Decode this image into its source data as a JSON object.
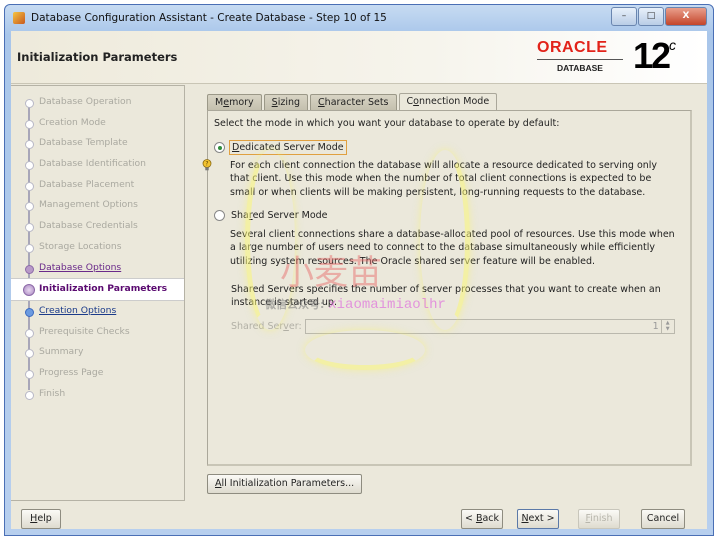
{
  "window": {
    "title": "Database Configuration Assistant - Create Database - Step 10 of 15",
    "minimize": "–",
    "maximize": "□",
    "close": "X"
  },
  "header": {
    "page_title": "Initialization Parameters",
    "logo_brand": "ORACLE",
    "logo_product": "DATABASE",
    "logo_version": "12",
    "logo_suffix": "c"
  },
  "sidebar": {
    "steps": [
      {
        "label": "Database Operation",
        "state": "done"
      },
      {
        "label": "Creation Mode",
        "state": "done"
      },
      {
        "label": "Database Template",
        "state": "done"
      },
      {
        "label": "Database Identification",
        "state": "done"
      },
      {
        "label": "Database Placement",
        "state": "done"
      },
      {
        "label": "Management Options",
        "state": "done"
      },
      {
        "label": "Database Credentials",
        "state": "done"
      },
      {
        "label": "Storage Locations",
        "state": "done"
      },
      {
        "label": "Database Options",
        "state": "visited"
      },
      {
        "label": "Initialization Parameters",
        "state": "current"
      },
      {
        "label": "Creation Options",
        "state": "next"
      },
      {
        "label": "Prerequisite Checks",
        "state": "pending"
      },
      {
        "label": "Summary",
        "state": "pending"
      },
      {
        "label": "Progress Page",
        "state": "pending"
      },
      {
        "label": "Finish",
        "state": "pending"
      }
    ]
  },
  "tabs": [
    {
      "pre": "M",
      "u": "e",
      "post": "mory",
      "active": false
    },
    {
      "pre": "",
      "u": "S",
      "post": "izing",
      "active": false
    },
    {
      "pre": "",
      "u": "C",
      "post": "haracter Sets",
      "active": false
    },
    {
      "pre": "C",
      "u": "o",
      "post": "nnection Mode",
      "active": true
    }
  ],
  "connection_mode": {
    "intro": "Select the mode in which you want your database to operate by default:",
    "dedicated": {
      "u": "D",
      "label_rest": "edicated Server Mode",
      "selected": true,
      "description": "For each client connection the database will allocate a resource dedicated to serving only that client.  Use this mode when the number of total client connections is expected to be small or when clients will be making persistent, long-running requests to the database."
    },
    "shared": {
      "pre": "Sha",
      "u": "r",
      "post": "ed Server Mode",
      "selected": false,
      "description": "Several client connections share a database-allocated pool of resources.  Use this mode when a large number of users need to connect to the database simultaneously while efficiently utilizing system resources.  The Oracle shared server feature will be enabled.",
      "servers_note": "Shared Servers specifies the number of server processes that you want to create when an instance is started up.",
      "field_pre": "Shared Ser",
      "field_u": "v",
      "field_post": "er:",
      "field_value": "1"
    }
  },
  "buttons": {
    "all_params_u": "A",
    "all_params_rest": "ll Initialization Parameters...",
    "help_u": "H",
    "help_rest": "elp",
    "back_pre": "< ",
    "back_u": "B",
    "back_post": "ack",
    "next_u": "N",
    "next_rest": "ext >",
    "finish_u": "F",
    "finish_rest": "inish",
    "cancel": "Cancel"
  },
  "watermark": {
    "big": "小麦苗",
    "label": "微信公众号:",
    "handle": "xiaomaimiaolhr"
  }
}
